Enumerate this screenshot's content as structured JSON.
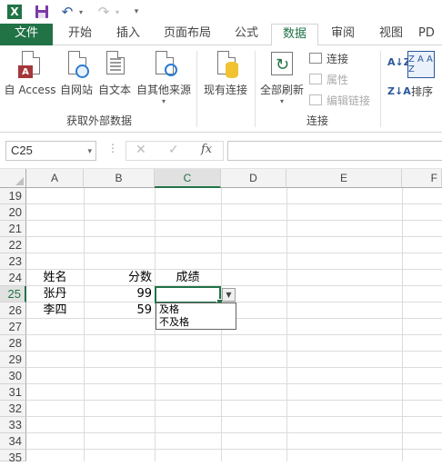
{
  "quick_access": {
    "logo": "X",
    "icons": [
      "excel-logo-icon",
      "save-icon",
      "undo-icon",
      "redo-icon",
      "customize-icon"
    ]
  },
  "tabs": [
    {
      "label": "文件"
    },
    {
      "label": "开始"
    },
    {
      "label": "插入"
    },
    {
      "label": "页面布局"
    },
    {
      "label": "公式"
    },
    {
      "label": "数据"
    },
    {
      "label": "审阅"
    },
    {
      "label": "视图"
    },
    {
      "label": "PD"
    }
  ],
  "active_tab": "数据",
  "ribbon": {
    "get_external": {
      "access": "自 Access",
      "web": "自网站",
      "text": "自文本",
      "other": "自其他来源",
      "group_label": "获取外部数据",
      "access_badge": "A"
    },
    "existing_connections": "现有连接",
    "connections": {
      "refresh_all": "全部刷新",
      "connections": "连接",
      "properties": "属性",
      "edit_links": "编辑链接",
      "group_label": "连接"
    },
    "sort": {
      "sort_label": "排序",
      "az": "A↓Z",
      "za": "Z↓A",
      "big": "Z A A Z"
    }
  },
  "formula_bar": {
    "name_box": "C25",
    "dots": "⋮",
    "cancel": "✕",
    "enter": "✓",
    "fx": "fx",
    "value": ""
  },
  "columns": [
    "A",
    "B",
    "C",
    "D",
    "E",
    "F"
  ],
  "rows": [
    "19",
    "20",
    "21",
    "22",
    "23",
    "24",
    "25",
    "26",
    "27",
    "28",
    "29",
    "30",
    "31",
    "32",
    "33",
    "34",
    "35"
  ],
  "cells": {
    "a24": "姓名",
    "b24": "分数",
    "c24": "成绩",
    "a25": "张丹",
    "b25": "99",
    "a26": "李四",
    "b26": "59"
  },
  "dropdown": {
    "options": [
      "及格",
      "不及格"
    ]
  },
  "colors": {
    "accent": "#217346",
    "file_tab": "#217346"
  }
}
